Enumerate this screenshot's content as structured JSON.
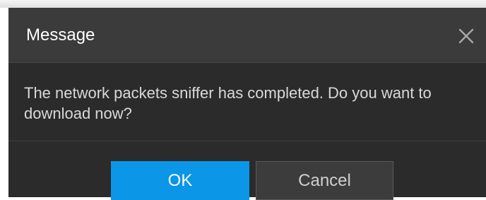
{
  "dialog": {
    "title": "Message",
    "close_icon": "close-icon",
    "message": "The network packets sniffer has completed. Do you want to download now?",
    "buttons": {
      "ok_label": "OK",
      "cancel_label": "Cancel"
    }
  },
  "colors": {
    "primary_button": "#0b96e8",
    "dialog_background": "#2b2b2b",
    "title_bar_background": "#3b3b3b"
  }
}
